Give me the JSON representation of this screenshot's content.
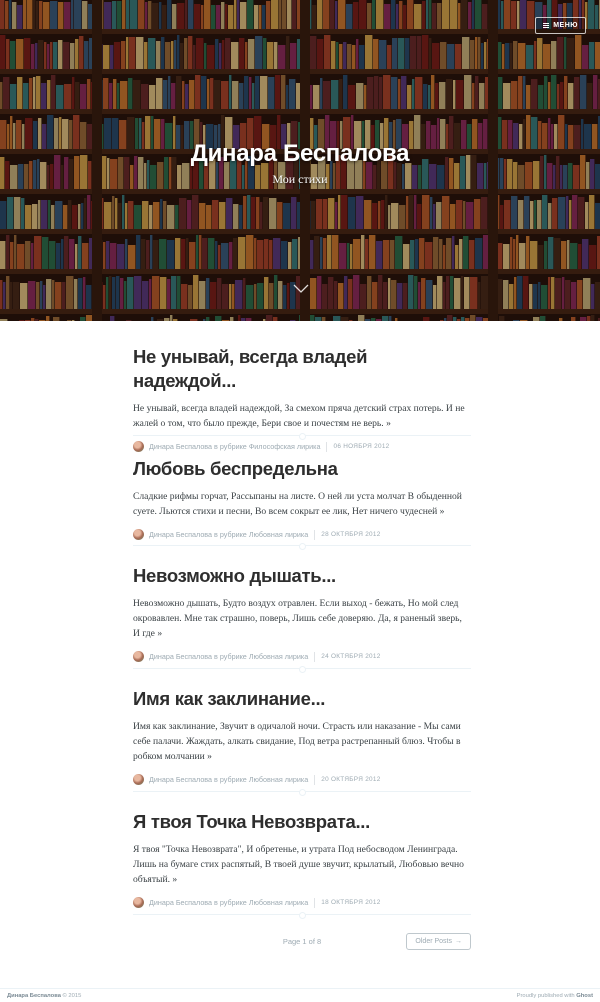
{
  "header": {
    "blog_title": "Динара Беспалова",
    "blog_description": "Мои стихи",
    "menu_label": "МЕНЮ"
  },
  "posts": [
    {
      "title": "Не унывай, всегда владей надеждой...",
      "excerpt": "Не унывай, всегда владей надеждой, За смехом пряча детский страх потерь. И не жалей о том, что было прежде, Бери свое и почестям не верь. »",
      "author": "Динара Беспалова",
      "in_label": "в рубрике",
      "category": "Философская лирика",
      "date": "06 ноября 2012"
    },
    {
      "title": "Любовь беспредельна",
      "excerpt": "Сладкие рифмы горчат, Рассыпаны на листе. О ней ли уста молчат В обыденной суете. Льются стихи и песни, Во всем сокрыт ее лик, Нет ничего чудесней »",
      "author": "Динара Беспалова",
      "in_label": "в рубрике",
      "category": "Любовная лирика",
      "date": "28 октября 2012"
    },
    {
      "title": "Невозможно дышать...",
      "excerpt": "Невозможно дышать, Будто воздух отравлен. Если выход - бежать, Но мой след окровавлен. Мне так страшно, поверь, Лишь себе доверяю. Да, я раненый зверь, И где »",
      "author": "Динара Беспалова",
      "in_label": "в рубрике",
      "category": "Любовная лирика",
      "date": "24 октября 2012"
    },
    {
      "title": "Имя как заклинание...",
      "excerpt": "Имя как заклинание, Звучит в одичалой ночи. Страсть или наказание - Мы сами себе палачи. Жаждать, алкать свидание, Под ветра растрепанный блюз. Чтобы в робком молчании »",
      "author": "Динара Беспалова",
      "in_label": "в рубрике",
      "category": "Любовная лирика",
      "date": "20 октября 2012"
    },
    {
      "title": "Я твоя Точка Невозврата...",
      "excerpt": "Я твоя \"Точка Невозврата\", И обретенье, и утрата Под небосводом Ленинграда. Лишь на бумаге стих распятый, В твоей душе звучит, крылатый, Любовью веч­но объятый. »",
      "author": "Динара Беспалова",
      "in_label": "в рубрике",
      "category": "Любовная лирика",
      "date": "18 октября 2012"
    }
  ],
  "pagination": {
    "page_label": "Page 1 of 8",
    "older_label": "Older Posts",
    "older_arrow": "→"
  },
  "footer": {
    "site_name": "Динара Беспалова",
    "copyright": "© 2015",
    "published_label": "Proudly published with",
    "platform": "Ghost"
  },
  "colors": {
    "accent_text": "#3a4145",
    "meta_text": "#9eabb3",
    "divider": "#ebf2f6"
  }
}
